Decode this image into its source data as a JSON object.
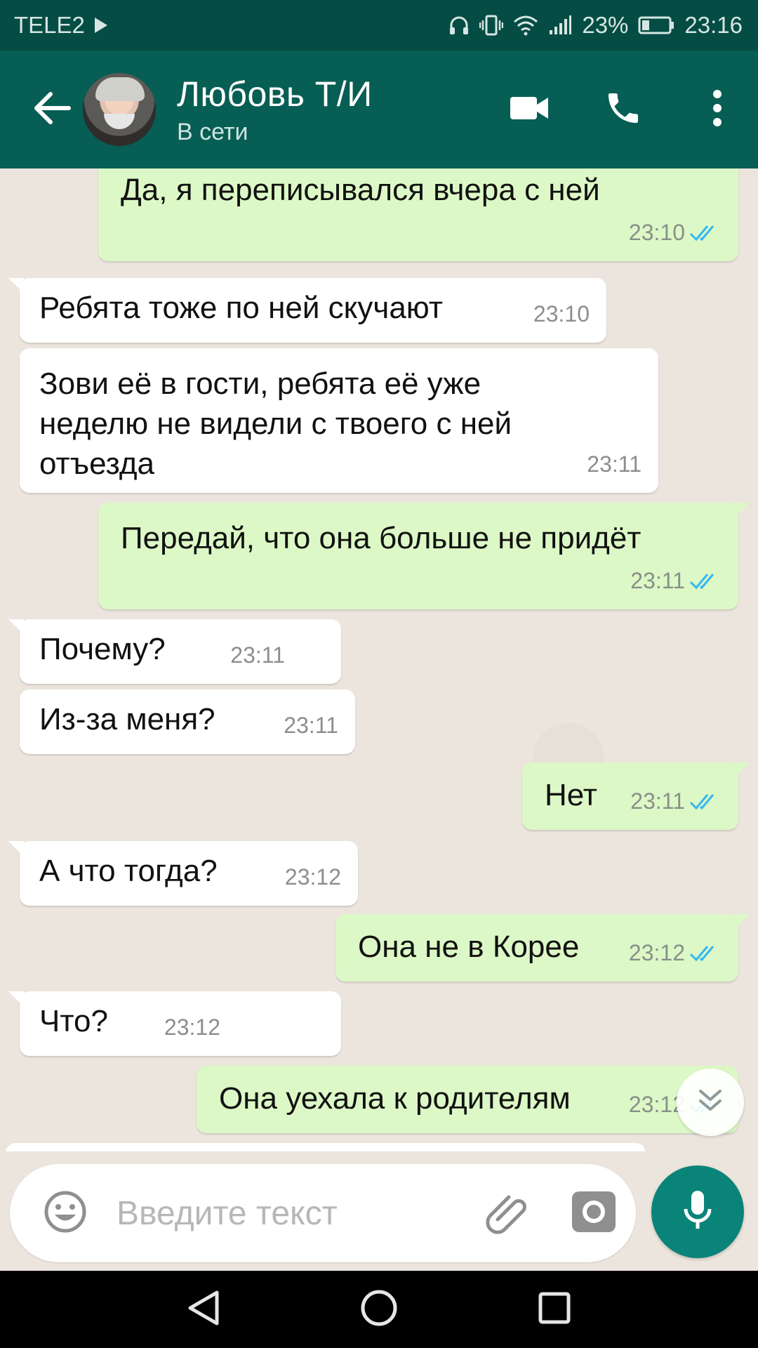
{
  "status_bar": {
    "carrier": "TELE2",
    "battery_percent": "23%",
    "time": "23:16",
    "icons": [
      "play-icon",
      "headphones-icon",
      "vibrate-icon",
      "wifi-icon",
      "signal-icon",
      "battery-icon"
    ]
  },
  "header": {
    "contact_name": "Любовь Т/И",
    "contact_status": "В сети",
    "icons": [
      "back-arrow-icon",
      "video-call-icon",
      "phone-icon",
      "more-vert-icon"
    ]
  },
  "messages": [
    {
      "direction": "out",
      "text": "Да, я переписывался вчера с ней",
      "time": "23:10",
      "read": true
    },
    {
      "direction": "in",
      "text": "Ребята тоже по ней скучают",
      "time": "23:10"
    },
    {
      "direction": "in",
      "text": "Зови её в гости, ребята её уже\nнеделю не видели с твоего с ней\nотъезда",
      "time": "23:11"
    },
    {
      "direction": "out",
      "text": "Передай, что она больше не придёт",
      "time": "23:11",
      "read": true
    },
    {
      "direction": "in",
      "text": "Почему?",
      "time": "23:11"
    },
    {
      "direction": "in",
      "text": "Из-за меня?",
      "time": "23:11"
    },
    {
      "direction": "out",
      "text": "Нет",
      "time": "23:11",
      "read": true
    },
    {
      "direction": "in",
      "text": "А что тогда?",
      "time": "23:12"
    },
    {
      "direction": "out",
      "text": "Она не в Корее",
      "time": "23:12",
      "read": true
    },
    {
      "direction": "in",
      "text": "Что?",
      "time": "23:12"
    },
    {
      "direction": "out",
      "text": "Она уехала к родителям",
      "time": "23:12",
      "read": true
    }
  ],
  "composer": {
    "placeholder": "Введите текст",
    "icons": [
      "emoji-icon",
      "attach-icon",
      "camera-icon",
      "mic-icon"
    ]
  },
  "colors": {
    "status_bar": "#054d44",
    "app_bar": "#075e54",
    "chat_background": "#ece5dd",
    "incoming_bubble": "#ffffff",
    "outgoing_bubble": "#dcf8c6",
    "read_ticks": "#34b7f1",
    "mic_button": "#0a8478"
  }
}
